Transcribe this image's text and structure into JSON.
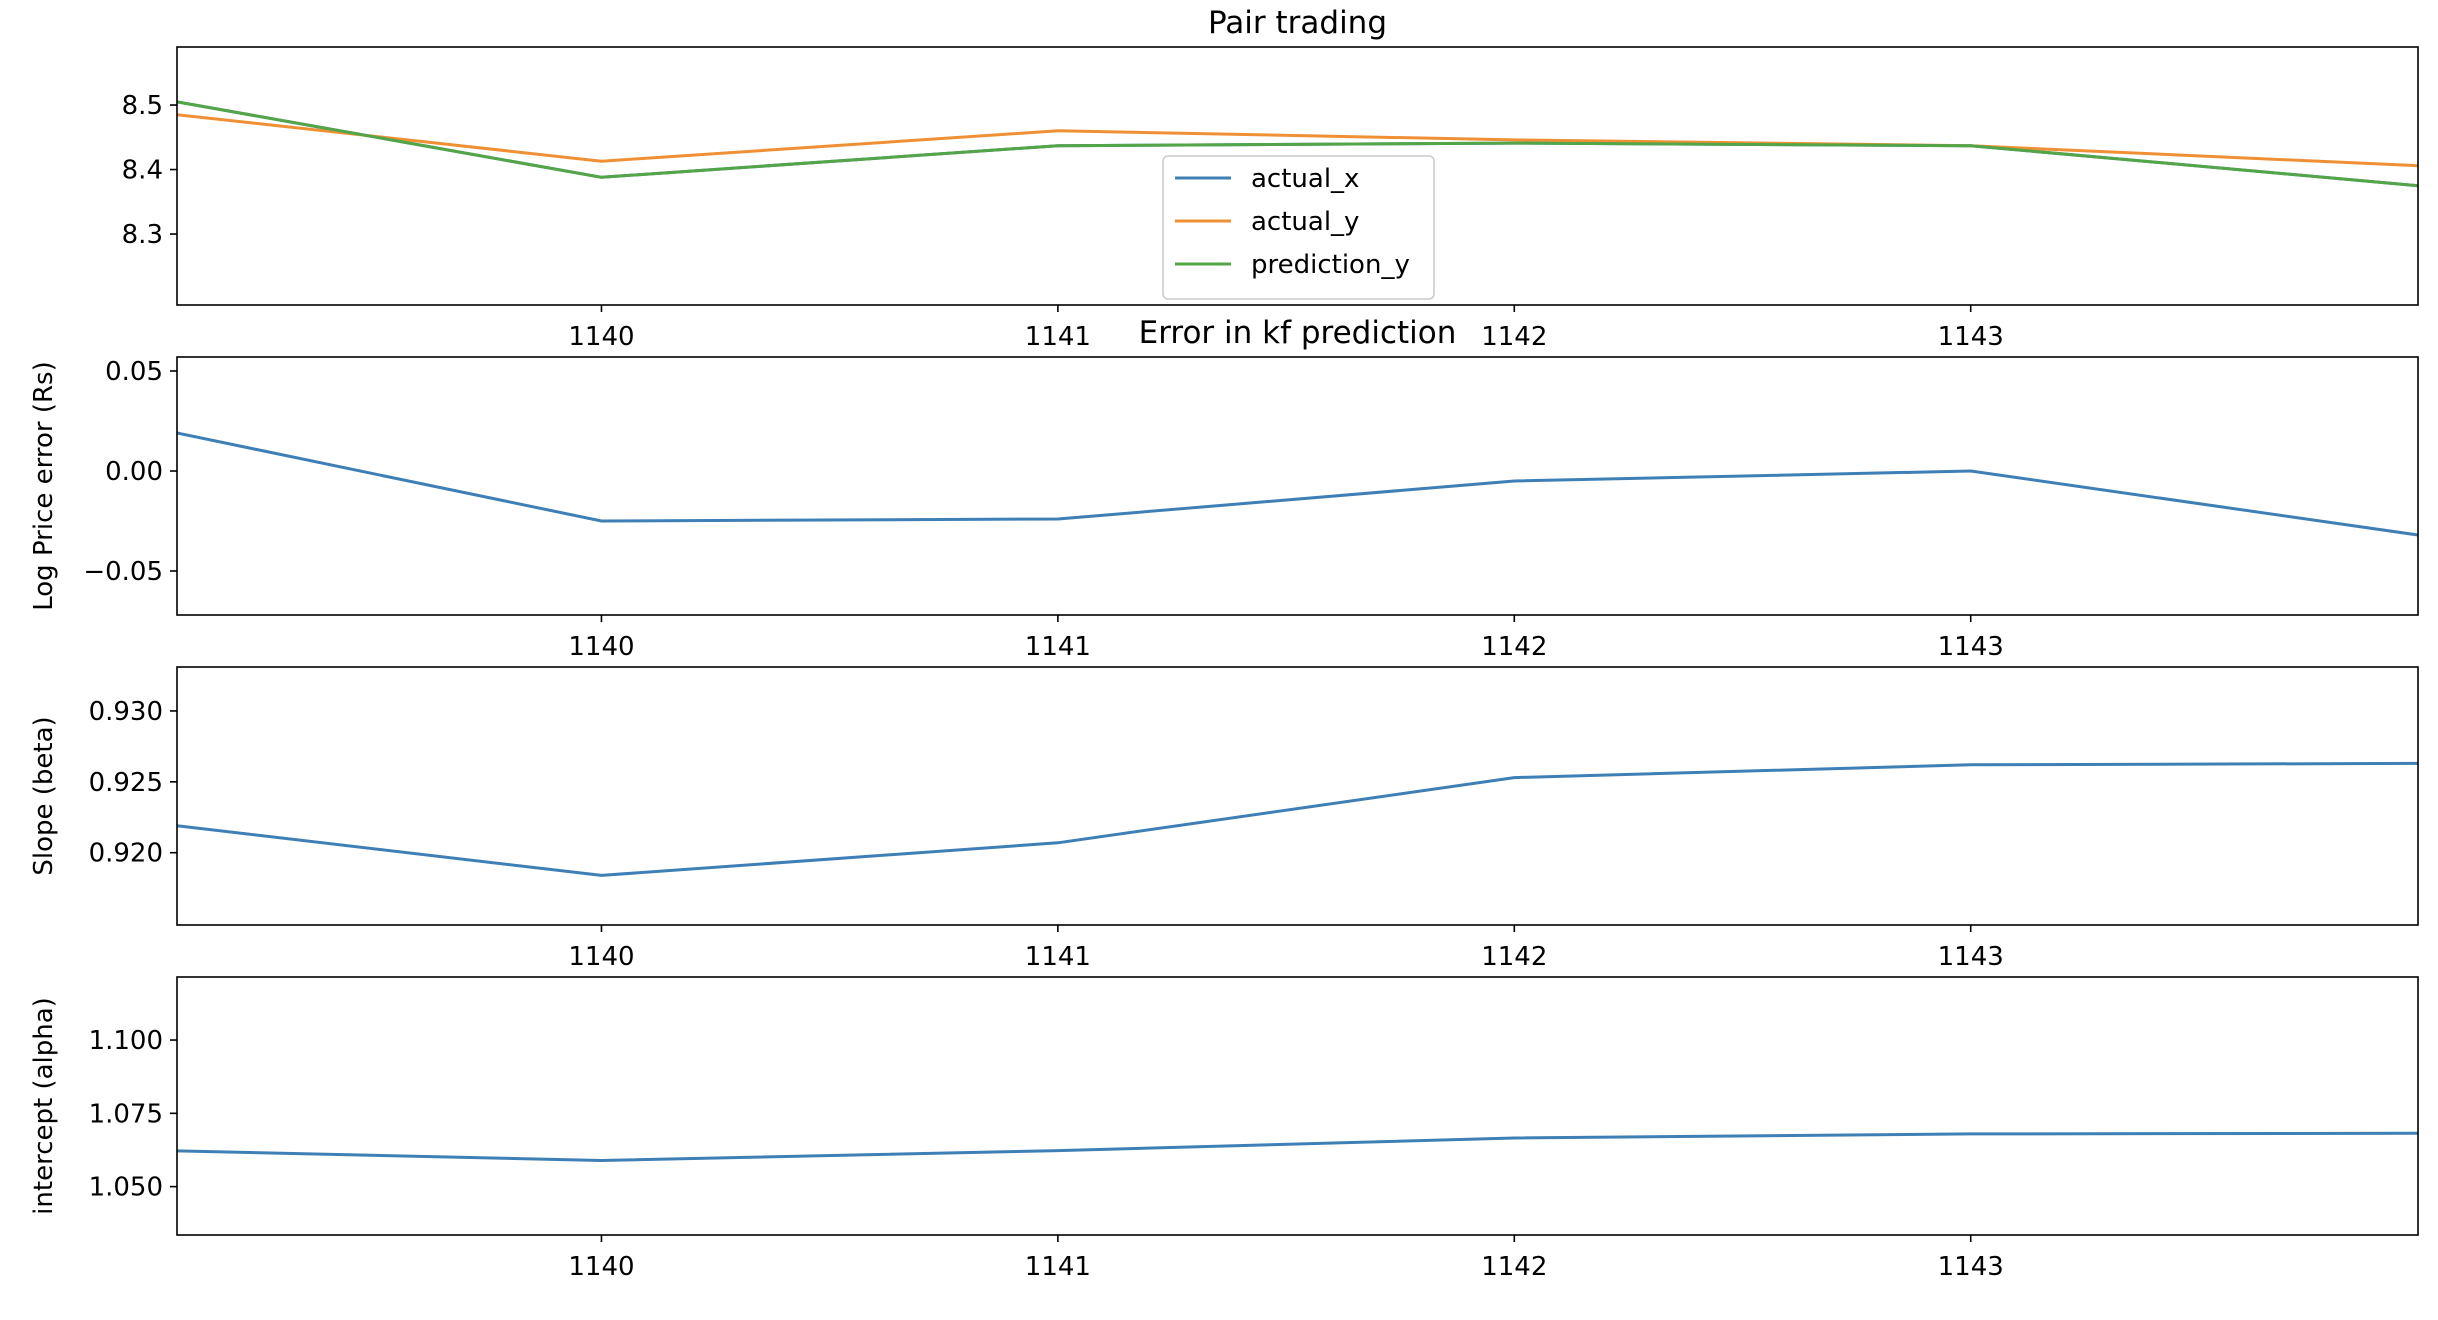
{
  "chart_data": [
    {
      "type": "line",
      "title": "Pair trading",
      "xlabel": "",
      "ylabel": "",
      "xlim": [
        1139.07,
        1143.98
      ],
      "ylim": [
        8.19,
        8.59
      ],
      "xticks": [
        1140,
        1141,
        1142,
        1143
      ],
      "xtick_labels": [
        "1140",
        "1141",
        "1142",
        "1143"
      ],
      "yticks": [
        8.3,
        8.4,
        8.5
      ],
      "ytick_labels": [
        "8.3",
        "8.4",
        "8.5"
      ],
      "x": [
        1139.07,
        1140,
        1141,
        1142,
        1143,
        1143.98
      ],
      "series": [
        {
          "name": "actual_x",
          "color": "#3e7fb5",
          "values": [
            8.505,
            8.388,
            8.437,
            8.441,
            8.437,
            8.375
          ]
        },
        {
          "name": "actual_y",
          "color": "#ef9035",
          "values": [
            8.485,
            8.413,
            8.46,
            8.446,
            8.437,
            8.406
          ]
        },
        {
          "name": "prediction_y",
          "color": "#53a548",
          "values": [
            8.505,
            8.388,
            8.437,
            8.441,
            8.437,
            8.375
          ]
        }
      ],
      "legend": "center-bottom",
      "grid": false
    },
    {
      "type": "line",
      "title": "Error in kf prediction",
      "xlabel": "",
      "ylabel": "Log Price error (Rs)",
      "xlim": [
        1139.07,
        1143.98
      ],
      "ylim": [
        -0.072,
        0.057
      ],
      "xticks": [
        1140,
        1141,
        1142,
        1143
      ],
      "xtick_labels": [
        "1140",
        "1141",
        "1142",
        "1143"
      ],
      "yticks": [
        -0.05,
        0.0,
        0.05
      ],
      "ytick_labels": [
        "−0.05",
        "0.00",
        "0.05"
      ],
      "x": [
        1139.07,
        1140,
        1141,
        1142,
        1143,
        1143.98
      ],
      "series": [
        {
          "color": "#3e7fb5",
          "values": [
            0.019,
            -0.025,
            -0.024,
            -0.005,
            0.0,
            -0.032
          ]
        }
      ],
      "grid": false
    },
    {
      "type": "line",
      "title": "",
      "xlabel": "",
      "ylabel": "Slope (beta)",
      "xlim": [
        1139.07,
        1143.98
      ],
      "ylim": [
        0.9149,
        0.9331
      ],
      "xticks": [
        1140,
        1141,
        1142,
        1143
      ],
      "xtick_labels": [
        "1140",
        "1141",
        "1142",
        "1143"
      ],
      "yticks": [
        0.92,
        0.925,
        0.93
      ],
      "ytick_labels": [
        "0.920",
        "0.925",
        "0.930"
      ],
      "x": [
        1139.07,
        1140,
        1141,
        1142,
        1143,
        1143.98
      ],
      "series": [
        {
          "color": "#3e7fb5",
          "values": [
            0.9219,
            0.9184,
            0.9207,
            0.9253,
            0.9262,
            0.9263
          ]
        }
      ],
      "grid": false
    },
    {
      "type": "line",
      "title": "",
      "xlabel": "",
      "ylabel": "intercept (alpha)",
      "xlim": [
        1139.07,
        1143.98
      ],
      "ylim": [
        1.0335,
        1.1215
      ],
      "xticks": [
        1140,
        1141,
        1142,
        1143
      ],
      "xtick_labels": [
        "1140",
        "1141",
        "1142",
        "1143"
      ],
      "yticks": [
        1.05,
        1.075,
        1.1
      ],
      "ytick_labels": [
        "1.050",
        "1.075",
        "1.100"
      ],
      "x": [
        1139.07,
        1140,
        1141,
        1142,
        1143,
        1143.98
      ],
      "series": [
        {
          "color": "#3e7fb5",
          "values": [
            1.0622,
            1.0589,
            1.0623,
            1.0666,
            1.068,
            1.0682
          ]
        }
      ],
      "grid": false
    }
  ]
}
